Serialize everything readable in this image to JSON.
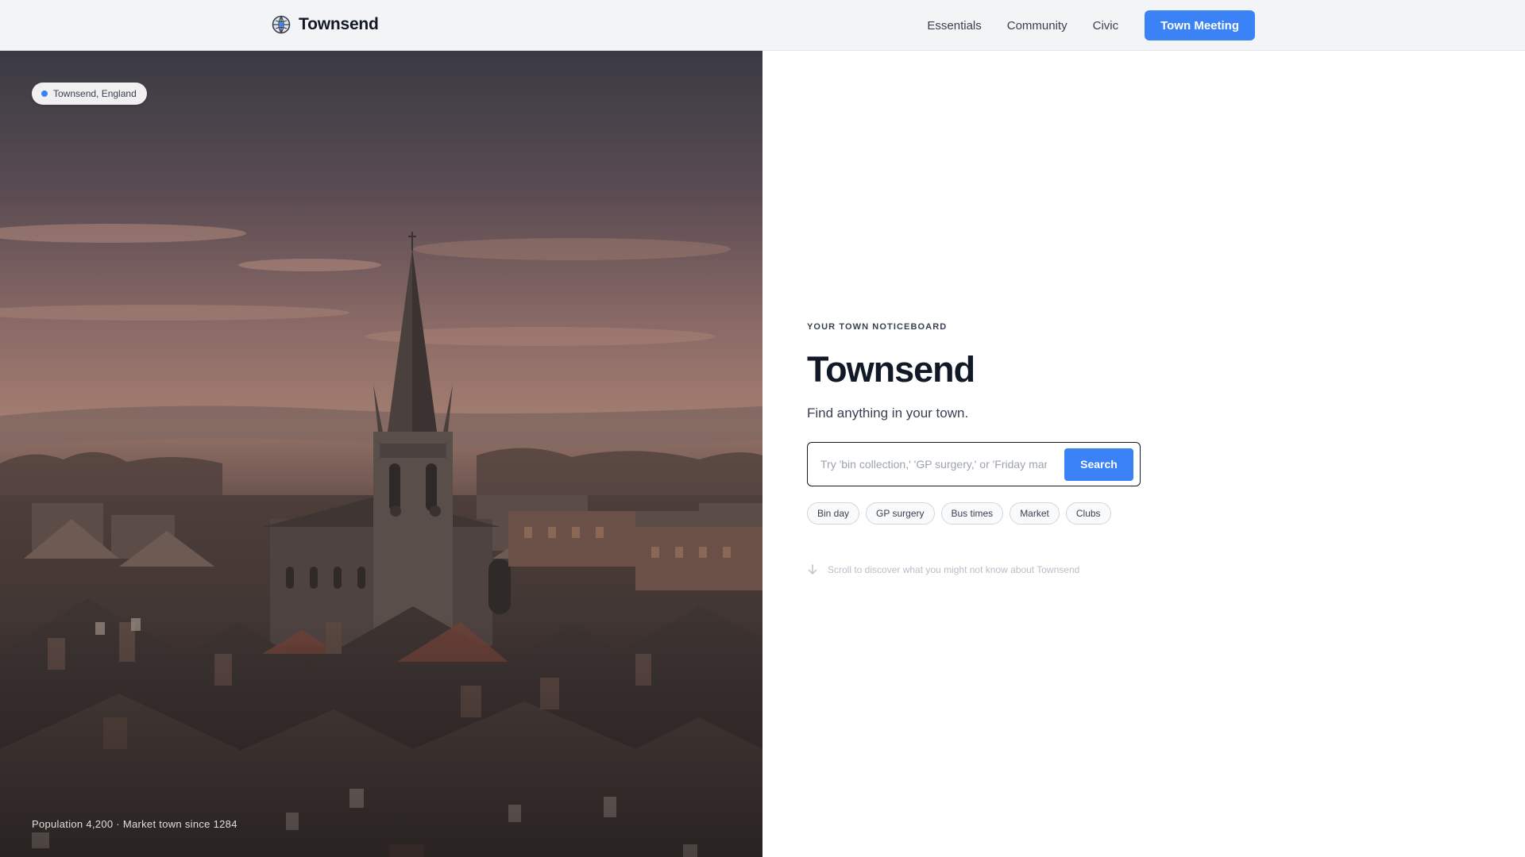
{
  "header": {
    "brand_name": "Townsend",
    "logo_icon": "globe-icon",
    "nav": [
      {
        "label": "Essentials"
      },
      {
        "label": "Community"
      },
      {
        "label": "Civic"
      }
    ],
    "cta_label": "Town Meeting"
  },
  "hero": {
    "location_label": "Townsend, England",
    "caption": "Population 4,200 · Market town since 1284"
  },
  "main": {
    "eyebrow": "YOUR TOWN NOTICEBOARD",
    "title": "Townsend",
    "subtitle": "Find anything in your town.",
    "search": {
      "placeholder": "Try 'bin collection,' 'GP surgery,' or 'Friday market'",
      "value": "",
      "button_label": "Search"
    },
    "quick_links": [
      {
        "label": "Bin day"
      },
      {
        "label": "GP surgery"
      },
      {
        "label": "Bus times"
      },
      {
        "label": "Market"
      },
      {
        "label": "Clubs"
      }
    ],
    "scroll_hint": "Scroll to discover what you might not know about Townsend",
    "scroll_icon": "arrow-down-icon"
  },
  "colors": {
    "accent": "#3b82f6",
    "header_bg": "#f3f4f6",
    "text_dark": "#111827"
  }
}
